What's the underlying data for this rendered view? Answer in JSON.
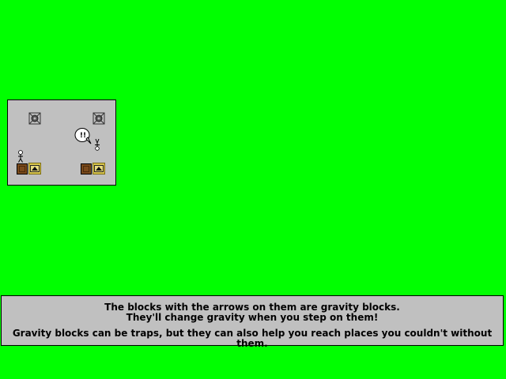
{
  "scene": {
    "background_color": "#00ff00",
    "preview_background": "#c0c0c0",
    "alert_glyph": "!!",
    "pieces": {
      "spinner_icon": "spinning-blade-icon",
      "dirt_icon": "brown-dirt-block-icon",
      "gravity_icon": "gravity-arrow-block-icon",
      "hero_icon": "stick-figure-player-icon",
      "alert_icon": "exclamation-speech-bubble-icon",
      "ghost_icon": "floating-player-icon"
    }
  },
  "message": {
    "line1": "The blocks with the arrows on them are gravity blocks.",
    "line2": "They'll change gravity when you step on them!",
    "line3": "Gravity blocks can be traps, but they can also help you reach places you couldn't without them."
  }
}
